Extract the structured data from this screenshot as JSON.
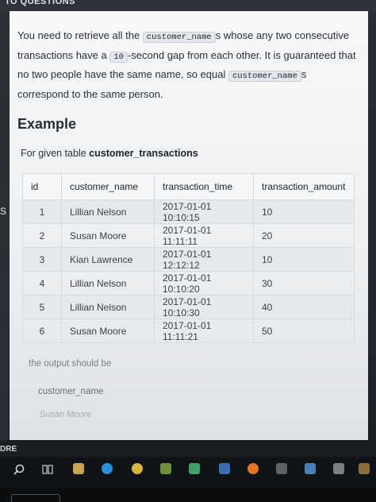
{
  "top_title": "TO QUESTIONS",
  "left_edge_label": "S",
  "left_bottom_label": "DRE",
  "description": {
    "p1": "You need to retrieve all the ",
    "code1": "customer_name",
    "p2": "s whose any two consecutive transactions have a ",
    "code2": "10",
    "p3": "-second gap from each other. It is guaranteed that no two people have the same name, so equal ",
    "code3": "customer_name",
    "p4": "s correspond to the same person."
  },
  "example_heading": "Example",
  "for_given": {
    "prefix": "For given table ",
    "table_name": "customer_transactions"
  },
  "table": {
    "headers": [
      "id",
      "customer_name",
      "transaction_time",
      "transaction_amount"
    ],
    "rows": [
      [
        "1",
        "Lillian Nelson",
        "2017-01-01 10:10:15",
        "10"
      ],
      [
        "2",
        "Susan Moore",
        "2017-01-01 11:11:11",
        "20"
      ],
      [
        "3",
        "Kian Lawrence",
        "2017-01-01 12:12:12",
        "10"
      ],
      [
        "4",
        "Lillian Nelson",
        "2017-01-01 10:10:20",
        "30"
      ],
      [
        "5",
        "Lillian Nelson",
        "2017-01-01 10:10:30",
        "40"
      ],
      [
        "6",
        "Susan Moore",
        "2017-01-01 11:11:21",
        "50"
      ]
    ]
  },
  "output_label": "the output should be",
  "output_header": "customer_name",
  "output_value": "Susan Moore",
  "colors": {
    "card_bg": "#f4f6f7",
    "code_bg": "#e3e8ee",
    "taskbar": "#111417"
  }
}
